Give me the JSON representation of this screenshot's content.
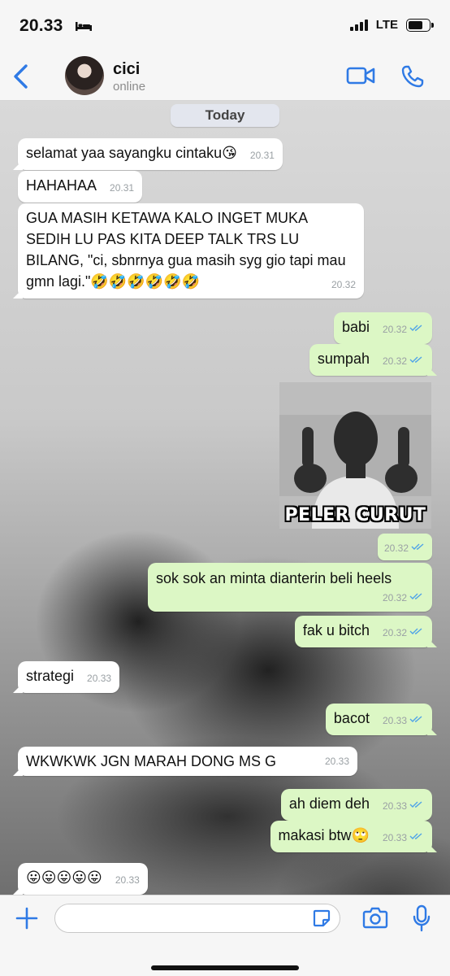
{
  "status_bar": {
    "time": "20.33",
    "network": "LTE",
    "battery_level": 0.7,
    "sleep_icon": "bed-icon"
  },
  "header": {
    "back_icon": "chevron-left-icon",
    "contact_name": "cici",
    "contact_status": "online",
    "video_icon": "video-camera-icon",
    "call_icon": "phone-icon",
    "accent_color": "#2f7ae5"
  },
  "chat": {
    "date_label": "Today",
    "messages": [
      {
        "direction": "in",
        "text": "selamat yaa sayangku cintaku😘",
        "time": "20.31"
      },
      {
        "direction": "in",
        "text": "HAHAHAA",
        "time": "20.31"
      },
      {
        "direction": "in",
        "text": "GUA MASIH KETAWA KALO INGET MUKA SEDIH LU PAS KITA DEEP TALK TRS LU BILANG, \"ci, sbnrnya gua masih syg gio tapi mau gmn lagi.\"🤣🤣🤣🤣🤣🤣",
        "time": "20.32"
      },
      {
        "direction": "out",
        "text": "babi",
        "time": "20.32",
        "read": true
      },
      {
        "direction": "out",
        "text": "sumpah",
        "time": "20.32",
        "read": true
      },
      {
        "direction": "out",
        "type": "sticker",
        "caption": "PELER CURUT",
        "time": "20.32",
        "read": true
      },
      {
        "direction": "out",
        "text": "sok sok an minta dianterin beli heels",
        "time": "20.32",
        "read": true
      },
      {
        "direction": "out",
        "text": "fak u bitch",
        "time": "20.32",
        "read": true
      },
      {
        "direction": "in",
        "text": "strategi",
        "time": "20.33"
      },
      {
        "direction": "out",
        "text": "bacot",
        "time": "20.33",
        "read": true
      },
      {
        "direction": "in",
        "text": "WKWKWK JGN MARAH DONG MS G",
        "time": "20.33"
      },
      {
        "direction": "out",
        "text": "ah diem deh",
        "time": "20.33",
        "read": true
      },
      {
        "direction": "out",
        "text": "makasi btw🙄",
        "time": "20.33",
        "read": true
      },
      {
        "direction": "in",
        "text": "😛😛😛😛😛",
        "time": "20.33"
      }
    ],
    "incoming_bubble_color": "#ffffff",
    "outgoing_bubble_color": "#dcf7c5",
    "read_tick_color": "#4fa3e8"
  },
  "composer": {
    "input_value": "",
    "plus_icon": "plus-icon",
    "sticker_icon": "sticker-icon",
    "camera_icon": "camera-icon",
    "mic_icon": "microphone-icon"
  }
}
